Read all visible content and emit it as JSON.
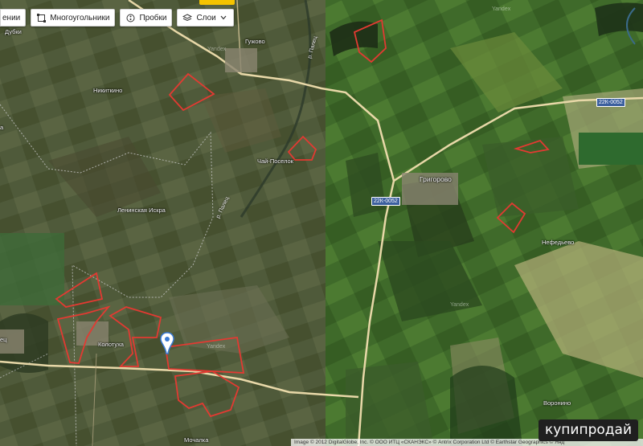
{
  "toolbar": {
    "layers_first_partial": "ении",
    "polygons": "Многоугольники",
    "traffic": "Пробки",
    "layers": "Слои"
  },
  "places": {
    "dubki": "Дубки",
    "guzhovo": "Гужово",
    "nikitkino": "Никиткино",
    "chai_poselok": "Чай-Поселок",
    "leninskaya_iskra": "Ленинская Искра",
    "kolotukha": "Колотуха",
    "grigorovo": "Григорово",
    "nefedevo": "Нефедьево",
    "voronino": "Воронино",
    "mochalka": "Мочалка",
    "edge_left_a": "а",
    "edge_left_b": "ец"
  },
  "rivers": {
    "palets_north": "р. Палец",
    "palets_south": "р. Палец"
  },
  "road_shields": {
    "east": "22К-0052",
    "center": "22К-0052"
  },
  "watermark": "Yandex",
  "brand": "купипродай",
  "attribution": "Image © 2012 DigitalGlobe, Inc. © ООО ИТЦ «СКАНЭКС» © Antrix Corporation Ltd © Earthstar Geographics © Янд",
  "colors": {
    "polygon_outline": "#e23a32",
    "road": "#e8d8a8",
    "toolbar_bg": "#ffffff",
    "brand_bg": "#1f1f1f",
    "accent_yellow": "#f5c400"
  }
}
